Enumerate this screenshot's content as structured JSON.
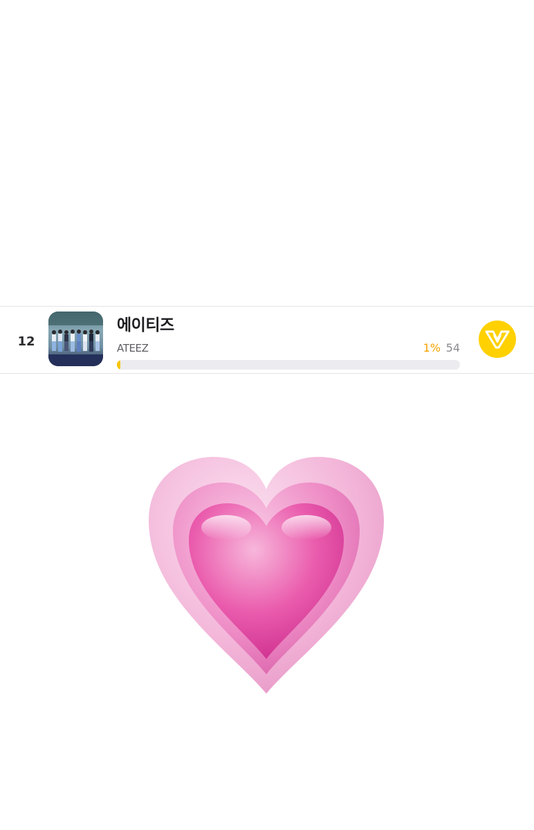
{
  "ranking": {
    "rank": "12",
    "name_korean": "에이티즈",
    "name_english": "ATEEZ",
    "vote_percent_label": "1%",
    "vote_percent_value": 1,
    "vote_count": "54",
    "thumbnail_icon": "group-photo",
    "vote_button_icon": "vote-logo-icon"
  },
  "emoji": {
    "icon": "growing-heart-icon"
  },
  "colors": {
    "accent_yellow": "#ffd100",
    "percent_orange": "#f5a300",
    "progress_fill": "#f7c500",
    "heart_pink": "#e43b9f"
  }
}
